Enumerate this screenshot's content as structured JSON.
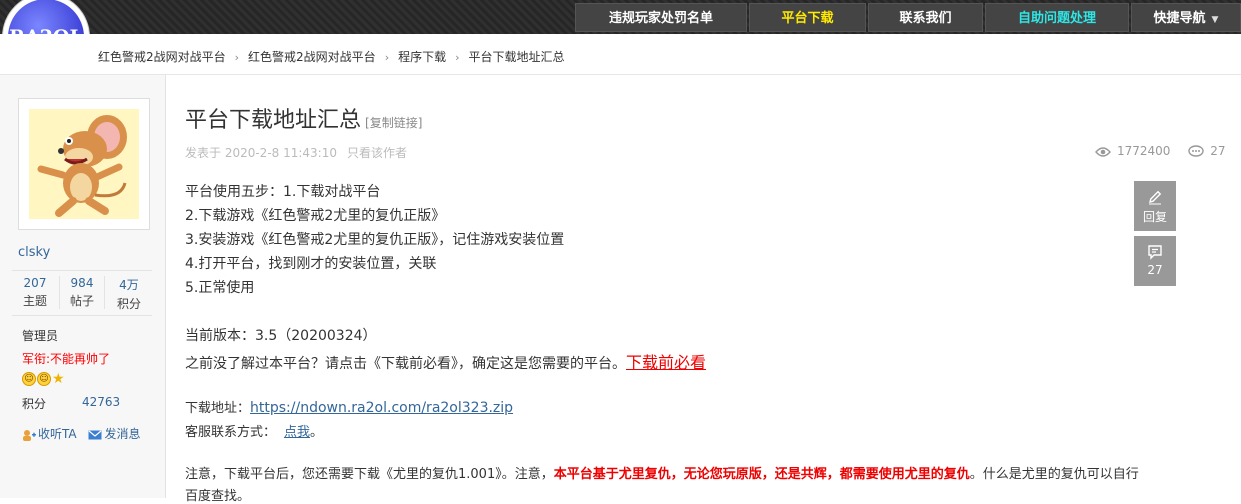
{
  "logo": {
    "text": "RA2OL"
  },
  "nav": [
    {
      "label": "违规玩家处罚名单",
      "style": "normal"
    },
    {
      "label": "平台下载",
      "style": "yellow"
    },
    {
      "label": "联系我们",
      "style": "normal"
    },
    {
      "label": "自助问题处理",
      "style": "cyan"
    },
    {
      "label": "快捷导航",
      "style": "normal"
    }
  ],
  "breadcrumb": [
    "红色警戒2战网对战平台",
    "红色警戒2战网对战平台",
    "程序下载",
    "平台下载地址汇总"
  ],
  "user": {
    "name": "clsky",
    "stats": [
      {
        "value": "207",
        "label": "主题"
      },
      {
        "value": "984",
        "label": "帖子"
      },
      {
        "value": "4万",
        "label": "积分"
      }
    ],
    "group": "管理员",
    "rank": "军衔:不能再帅了",
    "score_label": "积分",
    "score_value": "42763",
    "listen_label": "收听TA",
    "message_label": "发消息"
  },
  "post": {
    "title": "平台下载地址汇总",
    "copy_link": "[复制链接]",
    "posted": "发表于 2020-2-8 11:43:10",
    "author_only": "只看该作者",
    "views": "1772400",
    "replies": "27",
    "lines": [
      "平台使用五步：1.下载对战平台",
      "2.下载游戏《红色警戒2尤里的复仇正版》",
      "3.安装游戏《红色警戒2尤里的复仇正版》，记住游戏安装位置",
      "4.打开平台，找到刚才的安装位置，关联",
      "5.正常使用"
    ],
    "version": "当前版本：3.5（20200324）",
    "intro": "之前没了解过本平台？请点击《下载前必看》，确定这是您需要的平台。",
    "intro_link": "下载前必看",
    "download_label": "下载地址：",
    "download_url": "https://ndown.ra2ol.com/ra2ol323.zip",
    "service_label": "客服联系方式：",
    "service_link": "点我",
    "service_end": "。",
    "notice_a": "注意，下载平台后，您还需要下载《尤里的复仇1.001》。注意，",
    "notice_red": "本平台基于尤里复仇，无论您玩原版，还是共辉，都需要使用尤里的复仇",
    "notice_b": "。什么是尤里的复仇可以自行",
    "notice_c": "百度查找。"
  },
  "side": {
    "reply_label": "回复",
    "comments_count": "27"
  }
}
